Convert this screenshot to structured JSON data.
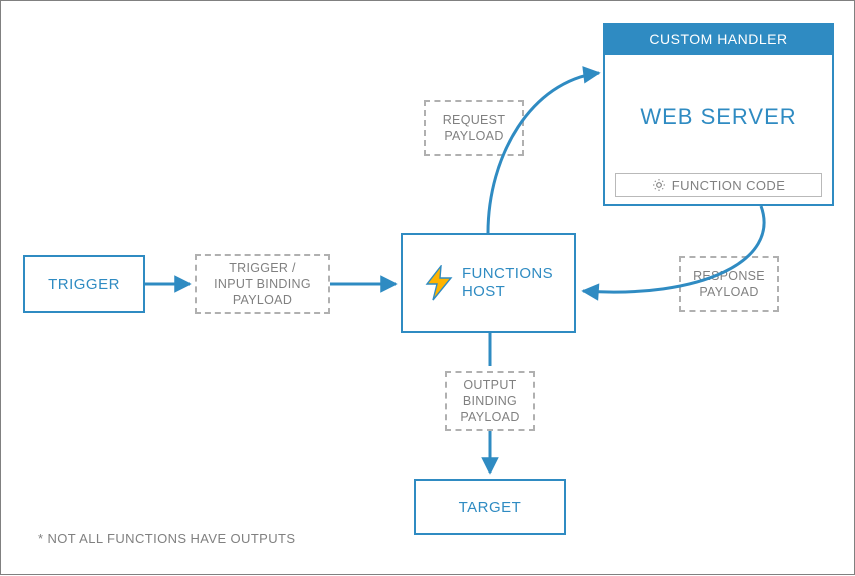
{
  "colors": {
    "accent": "#2f8bc2",
    "arrow": "#2f8bc2",
    "muted": "#808080"
  },
  "trigger": {
    "label": "TRIGGER"
  },
  "input_payload": {
    "line1": "TRIGGER /",
    "line2": "INPUT BINDING",
    "line3": "PAYLOAD"
  },
  "functions_host": {
    "label_line1": "FUNCTIONS",
    "label_line2": "HOST",
    "icon": "lightning-bolt"
  },
  "request_payload": {
    "line1": "REQUEST",
    "line2": "PAYLOAD"
  },
  "response_payload": {
    "line1": "RESPONSE",
    "line2": "PAYLOAD"
  },
  "output_payload": {
    "line1": "OUTPUT",
    "line2": "BINDING",
    "line3": "PAYLOAD"
  },
  "target": {
    "label": "TARGET"
  },
  "custom_handler": {
    "header": "CUSTOM HANDLER",
    "web_server": "WEB SERVER",
    "function_code": {
      "label": "FUNCTION CODE",
      "icon": "gear"
    }
  },
  "footnote": "* NOT ALL FUNCTIONS HAVE OUTPUTS"
}
